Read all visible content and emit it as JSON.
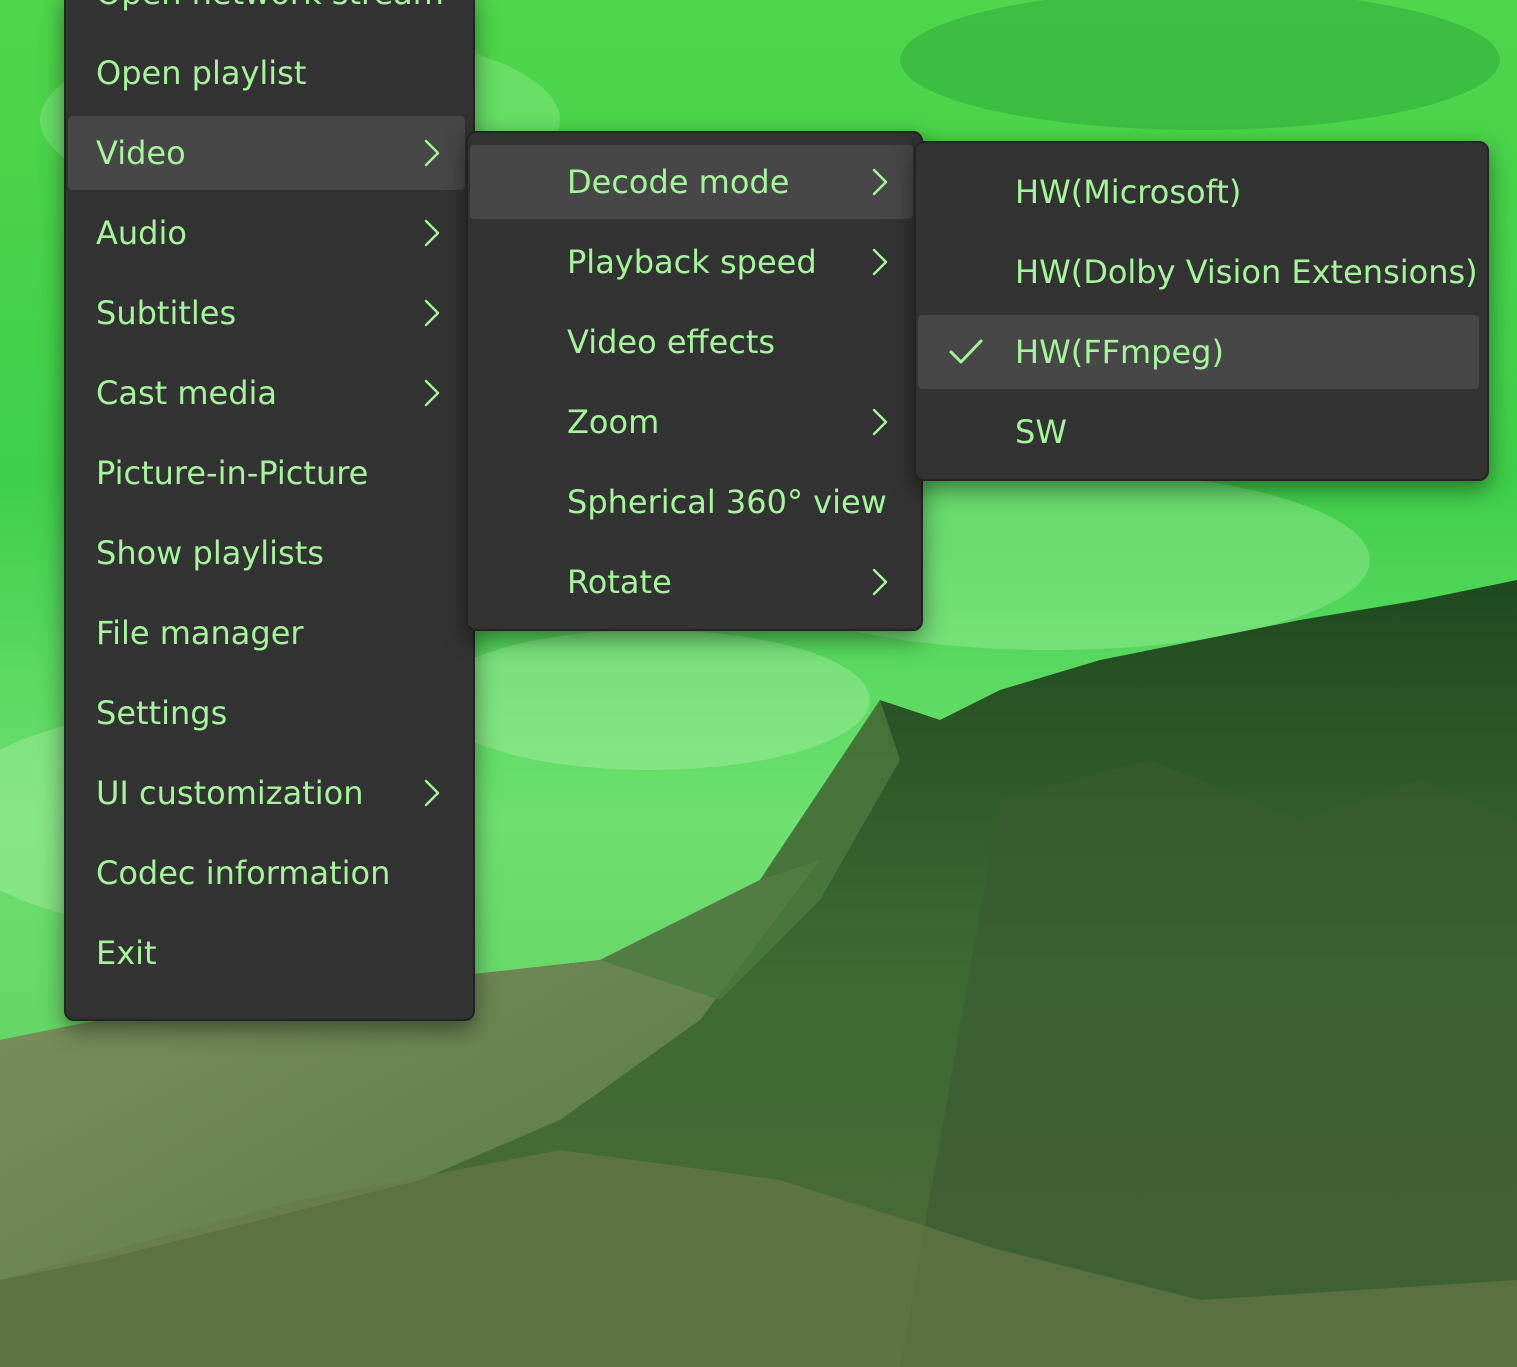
{
  "main_menu": {
    "items": [
      {
        "label": "Open network stream",
        "submenu": false
      },
      {
        "label": "Open playlist",
        "submenu": false
      },
      {
        "label": "Video",
        "submenu": true
      },
      {
        "label": "Audio",
        "submenu": true
      },
      {
        "label": "Subtitles",
        "submenu": true
      },
      {
        "label": "Cast media",
        "submenu": true
      },
      {
        "label": "Picture-in-Picture",
        "submenu": false
      },
      {
        "label": "Show playlists",
        "submenu": false
      },
      {
        "label": "File manager",
        "submenu": false
      },
      {
        "label": "Settings",
        "submenu": false
      },
      {
        "label": "UI customization",
        "submenu": true
      },
      {
        "label": "Codec information",
        "submenu": false
      },
      {
        "label": "Exit",
        "submenu": false
      }
    ]
  },
  "video_menu": {
    "items": [
      {
        "label": "Decode mode",
        "submenu": true
      },
      {
        "label": "Playback speed",
        "submenu": true
      },
      {
        "label": "Video effects",
        "submenu": false
      },
      {
        "label": "Zoom",
        "submenu": true
      },
      {
        "label": "Spherical 360° view",
        "submenu": false
      },
      {
        "label": "Rotate",
        "submenu": true
      }
    ]
  },
  "decode_menu": {
    "items": [
      {
        "label": "HW(Microsoft)",
        "checked": false
      },
      {
        "label": "HW(Dolby Vision Extensions)",
        "checked": false
      },
      {
        "label": "HW(FFmpeg)",
        "checked": true
      },
      {
        "label": "SW",
        "checked": false
      }
    ]
  },
  "colors": {
    "text": "#a5f59b",
    "menu_bg": "#333333",
    "hover_bg": "#474747"
  }
}
